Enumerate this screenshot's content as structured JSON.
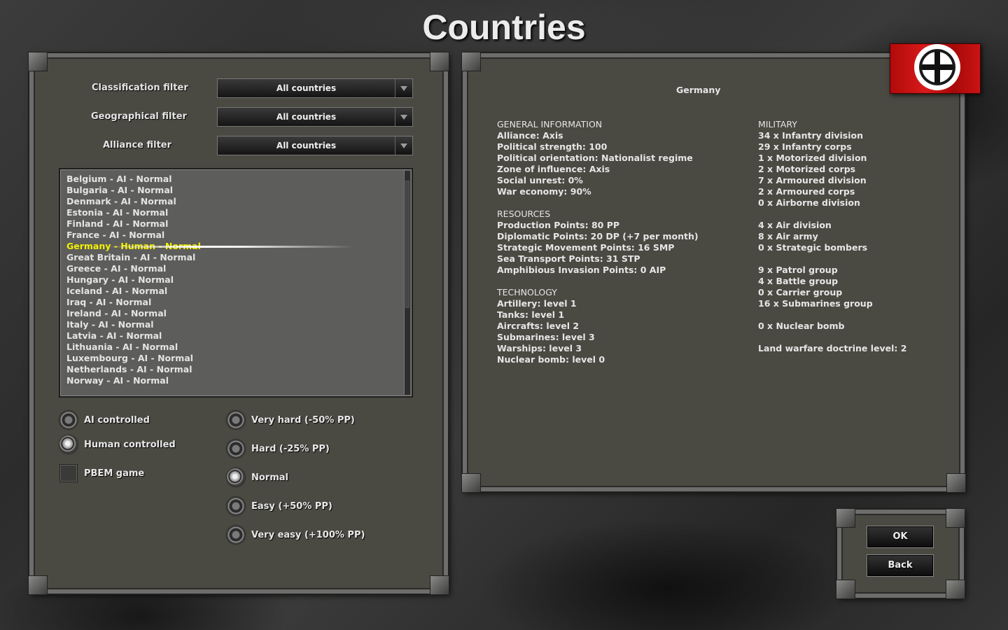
{
  "screen": {
    "title": "Countries"
  },
  "filters": [
    {
      "label": "Classification filter",
      "value": "All countries"
    },
    {
      "label": "Geographical filter",
      "value": "All countries"
    },
    {
      "label": "Alliance filter",
      "value": "All countries"
    }
  ],
  "country_list": {
    "items": [
      "Belgium - AI - Normal",
      "Bulgaria - AI - Normal",
      "Denmark - AI - Normal",
      "Estonia - AI - Normal",
      "Finland - AI - Normal",
      "France - AI - Normal",
      "Germany - Human - Normal",
      "Great Britain - AI - Normal",
      "Greece - AI - Normal",
      "Hungary - AI - Normal",
      "Iceland - AI - Normal",
      "Iraq - AI - Normal",
      "Ireland - AI - Normal",
      "Italy - AI - Normal",
      "Latvia - AI - Normal",
      "Lithuania - AI - Normal",
      "Luxembourg - AI - Normal",
      "Netherlands - AI - Normal",
      "Norway - AI - Normal"
    ],
    "selected_index": 6,
    "selected_color": "#f3f000"
  },
  "control_options": {
    "ai": "AI controlled",
    "human": "Human controlled",
    "pbem": "PBEM game",
    "selected": "human"
  },
  "difficulty_options": {
    "items": [
      "Very hard (-50% PP)",
      "Hard (-25% PP)",
      "Normal",
      "Easy (+50% PP)",
      "Very easy (+100% PP)"
    ],
    "selected_index": 2
  },
  "country_info": {
    "name": "Germany",
    "general": {
      "heading": "GENERAL INFORMATION",
      "lines": [
        "Alliance: Axis",
        "Political strength: 100",
        "Political orientation: Nationalist regime",
        "Zone of influence: Axis",
        "Social unrest: 0%",
        "War economy: 90%"
      ]
    },
    "resources": {
      "heading": "RESOURCES",
      "lines": [
        "Production Points: 80 PP",
        "Diplomatic Points: 20 DP (+7 per month)",
        "Strategic Movement Points: 16 SMP",
        "Sea Transport Points: 31 STP",
        "Amphibious Invasion Points: 0 AIP"
      ]
    },
    "technology": {
      "heading": "TECHNOLOGY",
      "lines": [
        "Artillery: level 1",
        "Tanks: level 1",
        "Aircrafts: level 2",
        "Submarines: level 3",
        "Warships: level 3",
        "Nuclear bomb: level 0"
      ]
    },
    "military": {
      "heading": "MILITARY",
      "land": [
        "34 x Infantry division",
        "29 x Infantry corps",
        "1 x Motorized division",
        "2 x Motorized corps",
        "7 x Armoured division",
        "2 x Armoured corps",
        "0 x Airborne division"
      ],
      "air": [
        "4 x Air division",
        "8 x Air army",
        "0 x Strategic bombers"
      ],
      "naval": [
        "9 x Patrol group",
        "4 x Battle group",
        "0 x Carrier group",
        "16 x Submarines group"
      ],
      "nuclear": "0 x Nuclear bomb",
      "doctrine": "Land warfare doctrine level: 2"
    },
    "flag_icon": "iron-cross-flag-icon"
  },
  "buttons": {
    "ok": "OK",
    "back": "Back"
  }
}
